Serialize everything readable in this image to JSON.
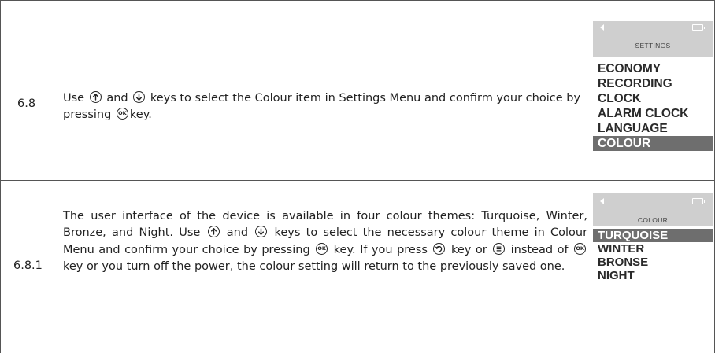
{
  "rows": [
    {
      "step": "6.8",
      "desc": {
        "before_up": "Use",
        "between_up_down": "and",
        "after_down": "keys to select the Colour item in Settings Menu and confirm your choice by pressing",
        "after_ok": "key."
      },
      "screen": {
        "title": "SETTINGS",
        "items": [
          "ECONOMY",
          "RECORDING",
          "CLOCK",
          "ALARM CLOCK",
          "LANGUAGE",
          "COLOUR"
        ],
        "selected": "COLOUR"
      }
    },
    {
      "step": "6.8.1",
      "desc": {
        "intro": "The user interface of the device is available in four colour themes: Turquoise, Winter, Bronze, and Night. Use",
        "between_up_down": "and",
        "after_down": "keys to select the necessary colour theme in Colour Menu and confirm your choice by pressing",
        "after_ok": "key. If you press",
        "after_back": "key or",
        "after_menu": "instead of",
        "after_ok2": "key or you turn off the power, the colour setting will return to the previously saved one."
      },
      "screen": {
        "title": "COLOUR",
        "items": [
          "TURQUOISE",
          "WINTER",
          "BRONSE",
          "NIGHT"
        ],
        "selected": "TURQUOISE"
      }
    }
  ],
  "icons": {
    "up": "arrow-up-circle-icon",
    "down": "arrow-down-circle-icon",
    "ok": "ok-circle-icon",
    "ok_label": "OK",
    "back": "back-circle-icon",
    "menu": "menu-circle-icon",
    "screen_back": "back-triangle-icon",
    "screen_battery": "battery-icon"
  },
  "colors": {
    "selected_row_bg": "#6e6e6e",
    "screen_header_bg": "#cfcfcf"
  }
}
